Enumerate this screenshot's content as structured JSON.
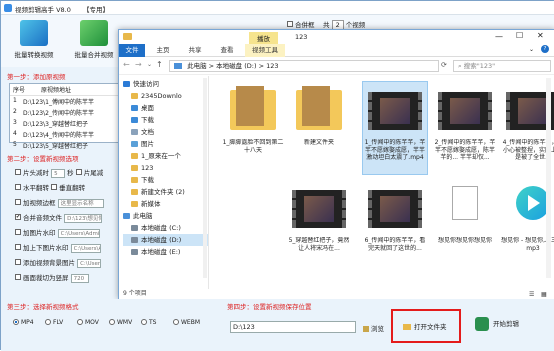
{
  "app": {
    "title": "视频剪辑高手 V8.0",
    "badge": "【专用】",
    "toolbar": [
      "批量转换视频",
      "批量合并视频"
    ],
    "topright": {
      "checkbox_label": "合併框",
      "count_prefix": "共",
      "count": "2",
      "count_suffix": "个视频"
    },
    "colors": {
      "accent": "#1e6fc8",
      "step": "#d22222",
      "highlight_red": "#e41b1b"
    }
  },
  "step1": {
    "label": "第一步：添加原视频",
    "columns": [
      "序号",
      "原视频地址"
    ],
    "rows": [
      {
        "num": "1",
        "path": "D:\\123\\1_傅闻中的陈芊芊"
      },
      {
        "num": "2",
        "path": "D:\\123\\2_传闻中的陈芊芊"
      },
      {
        "num": "3",
        "path": "D:\\123\\3_穿越替红把子"
      },
      {
        "num": "4",
        "path": "D:\\123\\4_传闻中的陈芊芊"
      },
      {
        "num": "5",
        "path": "D:\\123\\5_穿越替红把子"
      }
    ]
  },
  "step2": {
    "label": "第二步：设置新视频选项",
    "options": [
      {
        "label": "片头减时",
        "value": "5",
        "unit": "秒",
        "extra": "片尾减"
      },
      {
        "label": "水平翻转",
        "extra": "垂直翻转"
      },
      {
        "label": "加视频边框",
        "placeholder": "这里显示名称"
      },
      {
        "label": "合并音频文件",
        "placeholder": "D:\\123\\想见你",
        "checked": true
      },
      {
        "label": "加图片水印",
        "placeholder": "C:\\Users\\Admin"
      },
      {
        "label": "加上下图片水印",
        "placeholder": "C:\\Users\\Admin"
      },
      {
        "label": "添加视频背景图片",
        "placeholder": "C:\\Users\\Admin"
      },
      {
        "label": "画面裁切为竖屏",
        "value": "720"
      }
    ]
  },
  "step3": {
    "label": "第三步：选择新视频格式",
    "formats": [
      "MP4",
      "FLV",
      "MOV",
      "WMV",
      "TS",
      "WEBM"
    ],
    "selected": "MP4"
  },
  "step4": {
    "label": "第四步：设置新视频保存位置",
    "path": "D:\\123",
    "browse": "浏览",
    "open_folder": "打开文件夹",
    "start": "开始剪辑"
  },
  "explorer": {
    "title": "123",
    "context_tab": "播放",
    "ribbon_tabs": [
      "文件",
      "主页",
      "共享",
      "查看",
      "视频工具"
    ],
    "breadcrumb": [
      "此电脑",
      "本地磁盘 (D:)",
      "123"
    ],
    "search_placeholder": "搜索\"123\"",
    "nav": [
      {
        "label": "快速访问",
        "icon": "star-icon",
        "color": "#2b7bd6"
      },
      {
        "label": "2345Downlo",
        "icon": "folder-icon",
        "color": "#e8b84a"
      },
      {
        "label": "桌面",
        "icon": "desktop-icon",
        "color": "#3b8ad8"
      },
      {
        "label": "下载",
        "icon": "download-icon",
        "color": "#3b8ad8"
      },
      {
        "label": "文档",
        "icon": "document-icon",
        "color": "#8aa2bb"
      },
      {
        "label": "图片",
        "icon": "picture-icon",
        "color": "#5aa0d8"
      },
      {
        "label": "1_原来在一个",
        "icon": "folder-icon",
        "color": "#e8b84a"
      },
      {
        "label": "123",
        "icon": "folder-icon",
        "color": "#e8b84a"
      },
      {
        "label": "下载",
        "icon": "folder-icon",
        "color": "#e8b84a"
      },
      {
        "label": "新建文件夹 (2)",
        "icon": "folder-icon",
        "color": "#e8b84a"
      },
      {
        "label": "新媒体",
        "icon": "folder-icon",
        "color": "#e8b84a"
      },
      {
        "label": "此电脑",
        "icon": "computer-icon",
        "color": "#4a90d9"
      },
      {
        "label": "本地磁盘 (C:)",
        "icon": "drive-icon",
        "color": "#7a8a9a"
      },
      {
        "label": "本地磁盘 (D:)",
        "icon": "drive-icon",
        "color": "#7a8a9a"
      },
      {
        "label": "本地磁盘 (E:)",
        "icon": "drive-icon",
        "color": "#7a8a9a"
      }
    ],
    "items": [
      {
        "name": "1_脚脚露脸不回到第二十八天",
        "type": "folder"
      },
      {
        "name": "新建文件夹",
        "type": "folder"
      },
      {
        "name": "1_传闻中的陈芊芊，芊芊不愿嫁娶成愿，芊芊激动坦白太震了.mp4",
        "type": "video"
      },
      {
        "name": "2_传闻中的陈芊芊，芊芊不愿嫁娶成愿，陈芊芊的... 芊芊却仅...",
        "type": "video"
      },
      {
        "name": "4_传闻中的陈芊芊，不小心被整捏，实际上我是被了全世...",
        "type": "video"
      },
      {
        "name": "5_穿越替红把子，竟然让人将宋冯在...",
        "type": "video"
      },
      {
        "name": "6_传闻中的陈芊芊，看完天就回了这世的...",
        "type": "video"
      },
      {
        "name": "想见你想见你想见你",
        "type": "file"
      },
      {
        "name": "想见你 - 想见你,八三夭.mp3",
        "type": "audio"
      }
    ],
    "status": "9 个项目"
  }
}
